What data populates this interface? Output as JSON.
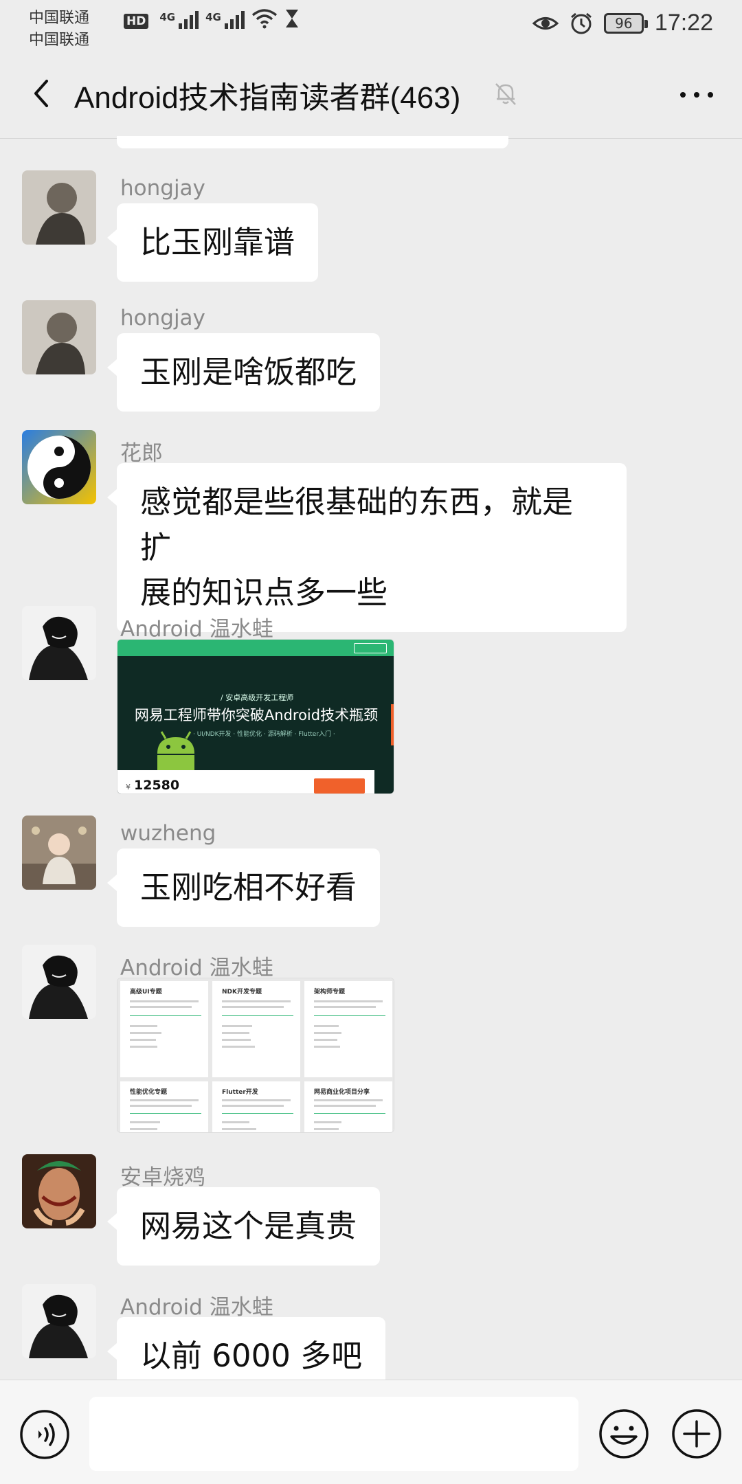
{
  "status_bar": {
    "carrier_1": "中国联通",
    "carrier_2": "中国联通",
    "hd": "HD",
    "signal_1_label": "4G",
    "signal_2_label": "4G",
    "battery": "96",
    "time": "17:22"
  },
  "header": {
    "title": "Android技术指南读者群(463)"
  },
  "messages": [
    {
      "sender": "hongjay",
      "text": "比玉刚靠谱"
    },
    {
      "sender": "hongjay",
      "text": "玉刚是啥饭都吃"
    },
    {
      "sender": "花郎",
      "line1": "感觉都是些很基础的东西，就是扩",
      "line2": "展的知识点多一些"
    },
    {
      "sender": "Android 温水蛙",
      "image": {
        "subtitle": "/ 安卓高级开发工程师",
        "headline": "网易工程师带你突破Android技术瓶颈",
        "tagline": "· UI/NDK开发 · 性能优化 · 源码解析 · Flutter入门 ·",
        "currency": "¥",
        "price": "12580"
      }
    },
    {
      "sender": "wuzheng",
      "text": "玉刚吃相不好看"
    },
    {
      "sender": "Android 温水蛙",
      "image": {
        "cells": [
          "高级UI专题",
          "NDK开发专题",
          "架构师专题",
          "性能优化专题",
          "Flutter开发",
          "网易商业化项目分享"
        ]
      }
    },
    {
      "sender": "安卓烧鸡",
      "text": "网易这个是真贵"
    },
    {
      "sender": "Android 温水蛙",
      "text": "以前 6000 多吧"
    }
  ],
  "input_bar": {
    "text_value": ""
  },
  "colors": {
    "background": "#ededed",
    "bubble": "#ffffff",
    "accent_green": "#2bb673",
    "ad_orange": "#f0612b"
  },
  "icons": [
    "back-arrow-icon",
    "mute-bell-icon",
    "more-dots-icon",
    "voice-icon",
    "emoji-icon",
    "plus-icon"
  ]
}
